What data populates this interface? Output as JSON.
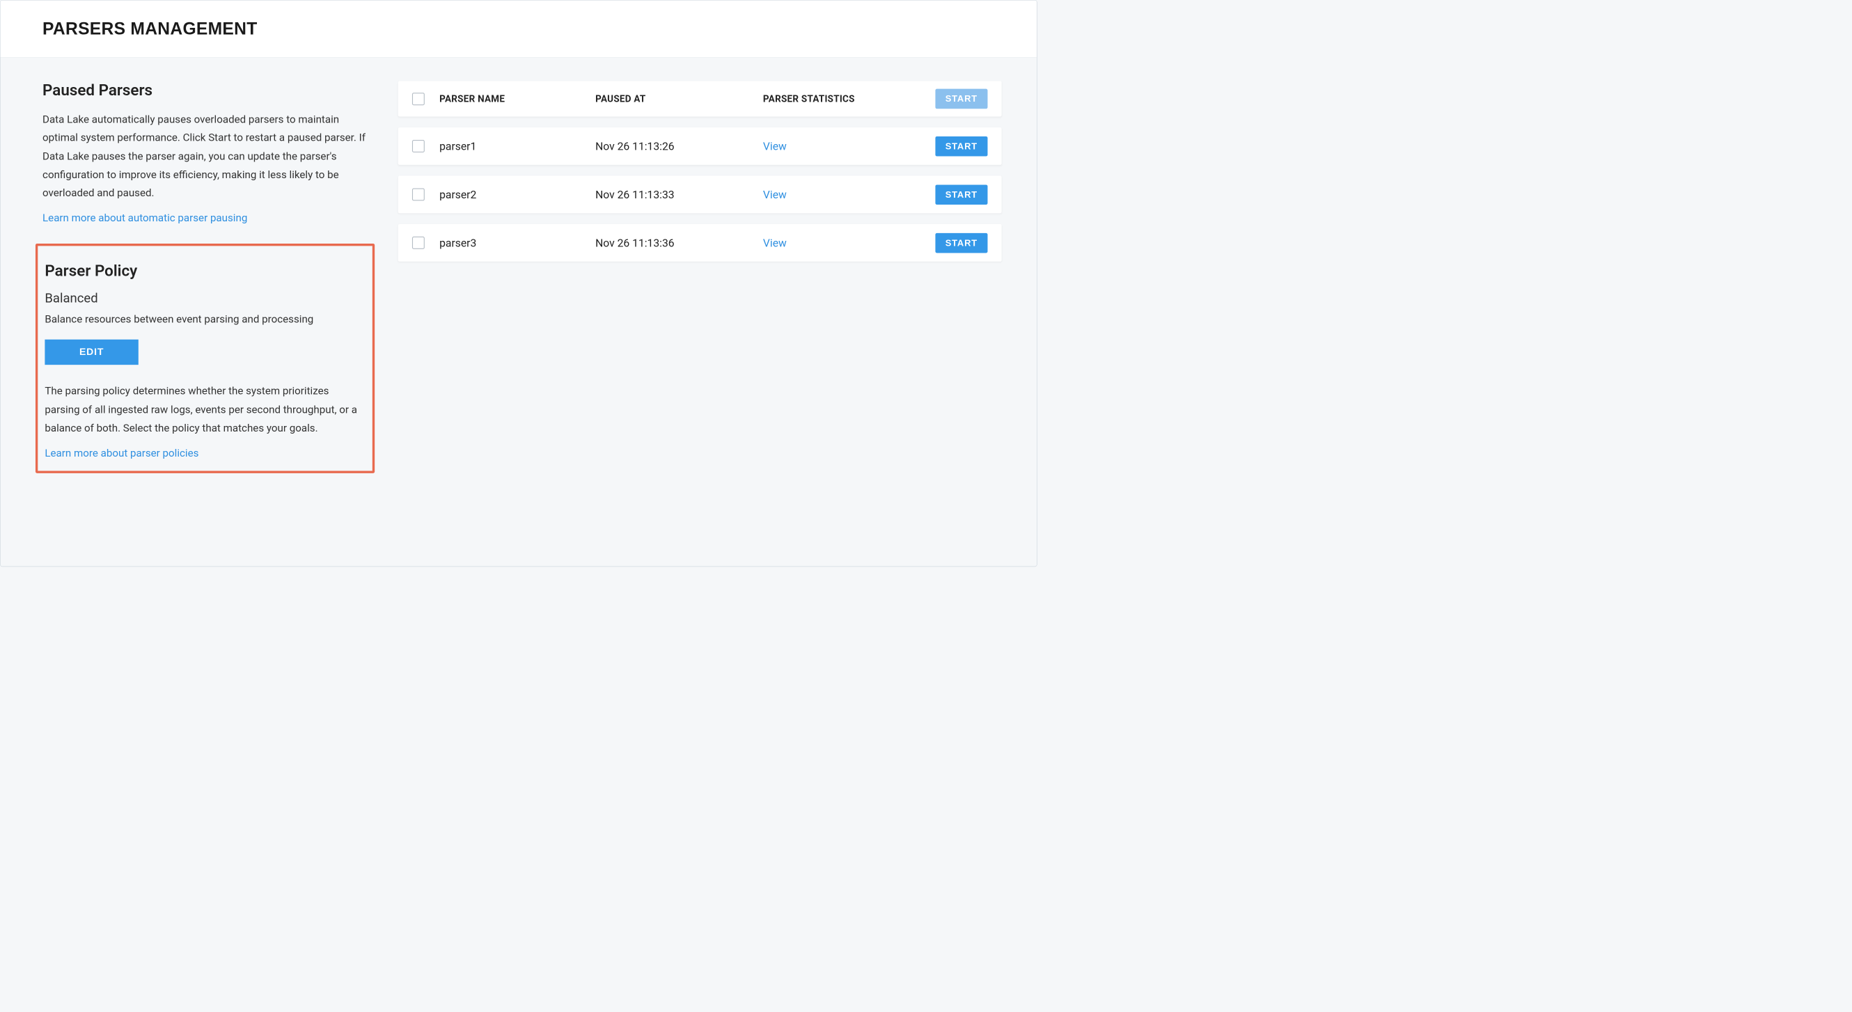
{
  "header": {
    "title": "PARSERS MANAGEMENT"
  },
  "paused": {
    "heading": "Paused Parsers",
    "body": "Data Lake automatically pauses overloaded parsers to maintain optimal system performance. Click Start to restart a paused parser. If Data Lake pauses the parser again, you can update the parser's configuration to improve its efficiency, making it less likely to be overloaded and paused.",
    "link": "Learn more about automatic parser pausing"
  },
  "policy": {
    "heading": "Parser Policy",
    "name": "Balanced",
    "short_desc": "Balance resources between event parsing and processing",
    "edit_label": "EDIT",
    "long_desc": "The parsing policy determines whether the system prioritizes parsing of all ingested raw logs, events per second throughput, or a balance of both. Select the policy that matches your goals.",
    "link": "Learn more about parser policies"
  },
  "table": {
    "columns": {
      "name": "PARSER NAME",
      "paused_at": "PAUSED AT",
      "stats": "PARSER STATISTICS"
    },
    "header_action": "START",
    "view_label": "View",
    "row_action": "START",
    "rows": [
      {
        "name": "parser1",
        "paused_at": "Nov 26 11:13:26"
      },
      {
        "name": "parser2",
        "paused_at": "Nov 26 11:13:33"
      },
      {
        "name": "parser3",
        "paused_at": "Nov 26 11:13:36"
      }
    ]
  }
}
